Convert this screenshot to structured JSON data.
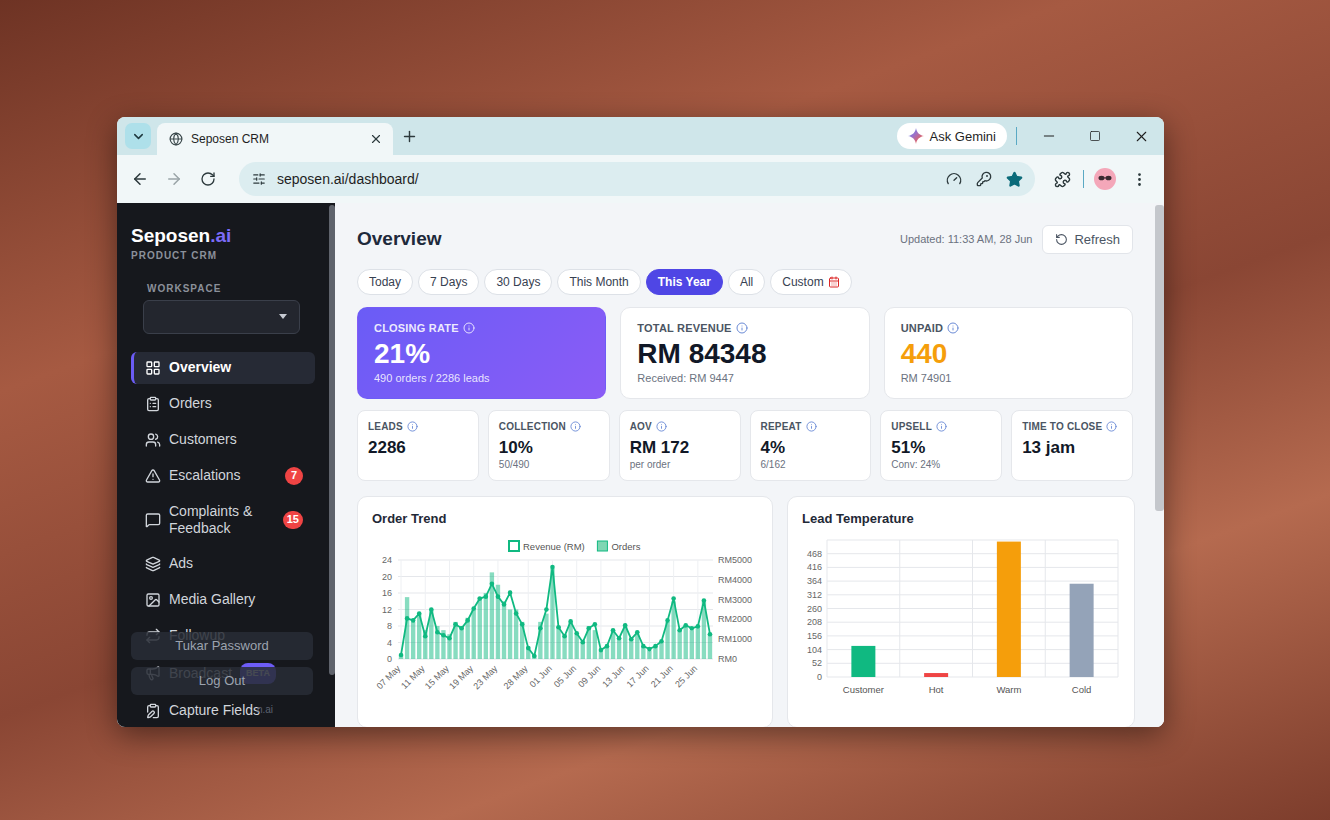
{
  "browser": {
    "tab": {
      "title": "Seposen CRM",
      "selected": true
    },
    "gemini_button": "Ask Gemini",
    "address": "seposen.ai/dashboard/",
    "bookmarked": true
  },
  "sidebar": {
    "logo": {
      "name": "Seposen",
      "suffix": ".ai",
      "tagline": "PRODUCT CRM"
    },
    "workspace_label": "WORKSPACE",
    "items": [
      {
        "label": "Overview",
        "selected": true
      },
      {
        "label": "Orders",
        "selected": false
      },
      {
        "label": "Customers",
        "selected": false
      },
      {
        "label": "Escalations",
        "selected": false,
        "badge": "7"
      },
      {
        "label": "Complaints & Feedback",
        "selected": false,
        "badge": "15"
      },
      {
        "label": "Ads",
        "selected": false
      },
      {
        "label": "Media Gallery",
        "selected": false
      },
      {
        "label": "Followup",
        "selected": false
      },
      {
        "label": "Broadcast",
        "selected": false,
        "tag": "BETA"
      },
      {
        "label": "Capture Fields",
        "selected": false
      }
    ],
    "account_menu": {
      "items": [
        "Tukar Password",
        "Log Out"
      ],
      "footer": "n.ai"
    }
  },
  "overview": {
    "title": "Overview",
    "updated": "Updated: 11:33 AM, 28 Jun",
    "refresh": "Refresh",
    "ranges": [
      {
        "label": "Today",
        "selected": false
      },
      {
        "label": "7 Days",
        "selected": false
      },
      {
        "label": "30 Days",
        "selected": false
      },
      {
        "label": "This Month",
        "selected": false
      },
      {
        "label": "This Year",
        "selected": true
      },
      {
        "label": "All",
        "selected": false
      },
      {
        "label": "Custom",
        "selected": false
      }
    ],
    "primary_cards": [
      {
        "label": "CLOSING RATE",
        "value": "21%",
        "note": "490 orders / 2286 leads",
        "kind": "highlight"
      },
      {
        "label": "TOTAL REVENUE",
        "value": "RM 84348",
        "note": "Received: RM 9447",
        "kind": "plain"
      },
      {
        "label": "UNPAID",
        "value": "440",
        "note": "RM 74901",
        "kind": "warning"
      }
    ],
    "metric_cards": [
      {
        "label": "LEADS",
        "value": "2286"
      },
      {
        "label": "COLLECTION",
        "value": "10%",
        "note": "50/490"
      },
      {
        "label": "AOV",
        "value": "RM 172",
        "note": "per order"
      },
      {
        "label": "REPEAT",
        "value": "4%",
        "note": "6/162"
      },
      {
        "label": "UPSELL",
        "value": "51%",
        "note": "Conv: 24%"
      },
      {
        "label": "TIME TO CLOSE",
        "value": "13 jam"
      }
    ]
  },
  "order_trend": {
    "title": "Order Trend",
    "left_axis": [
      "0",
      "4",
      "8",
      "12",
      "16",
      "20",
      "24"
    ],
    "right_axis": [
      "RM0",
      "RM1000",
      "RM2000",
      "RM3000",
      "RM4000",
      "RM5000"
    ],
    "x_labels": [
      {
        "label": "07 May",
        "point": 0
      },
      {
        "label": "11 May",
        "point": 4
      },
      {
        "label": "15 May",
        "point": 8
      },
      {
        "label": "19 May",
        "point": 12
      },
      {
        "label": "23 May",
        "point": 16
      },
      {
        "label": "28 May",
        "point": 21
      },
      {
        "label": "01 Jun",
        "point": 25
      },
      {
        "label": "05 Jun",
        "point": 29
      },
      {
        "label": "09 Jun",
        "point": 33
      },
      {
        "label": "13 Jun",
        "point": 37
      },
      {
        "label": "17 Jun",
        "point": 41
      },
      {
        "label": "21 Jun",
        "point": 45
      },
      {
        "label": "25 Jun",
        "point": 49
      }
    ],
    "series": [
      {
        "name": "Revenue (RM)",
        "kind": "line",
        "axis": "right",
        "values": [
          200,
          2050,
          1950,
          2300,
          1150,
          2500,
          1350,
          1200,
          1050,
          1750,
          1550,
          1950,
          2550,
          3050,
          3150,
          3800,
          3150,
          2750,
          3350,
          2300,
          1750,
          550,
          150,
          1550,
          2500,
          4650,
          1600,
          1150,
          1900,
          1300,
          850,
          1550,
          1750,
          450,
          650,
          1450,
          1050,
          1700,
          1000,
          1350,
          650,
          500,
          650,
          900,
          1950,
          3050,
          1450,
          1700,
          1550,
          1650,
          2950,
          1250
        ]
      },
      {
        "name": "Orders",
        "kind": "bar",
        "axis": "left",
        "values": [
          1,
          15,
          9,
          11,
          7,
          12,
          8,
          7,
          6,
          9,
          8,
          10,
          12,
          15,
          16,
          21,
          18,
          14,
          12,
          12,
          9,
          3,
          1,
          9,
          11,
          22,
          8,
          6,
          9,
          6,
          4,
          8,
          7,
          2,
          3,
          7,
          5,
          8,
          5,
          6,
          3,
          2,
          3,
          4,
          9,
          14,
          7,
          8,
          7,
          8,
          14,
          6
        ]
      }
    ]
  },
  "lead_temperature": {
    "title": "Lead Temperature",
    "ticks": [
      "0",
      "52",
      "104",
      "156",
      "208",
      "260",
      "312",
      "364",
      "416",
      "468"
    ],
    "bars": [
      {
        "label": "Customer",
        "value": 118,
        "color": "#10b981"
      },
      {
        "label": "Hot",
        "value": 15,
        "color": "#ef4444"
      },
      {
        "label": "Warm",
        "value": 514,
        "color": "#f59e0b"
      },
      {
        "label": "Cold",
        "value": 354,
        "color": "#94a3b8"
      }
    ]
  }
}
